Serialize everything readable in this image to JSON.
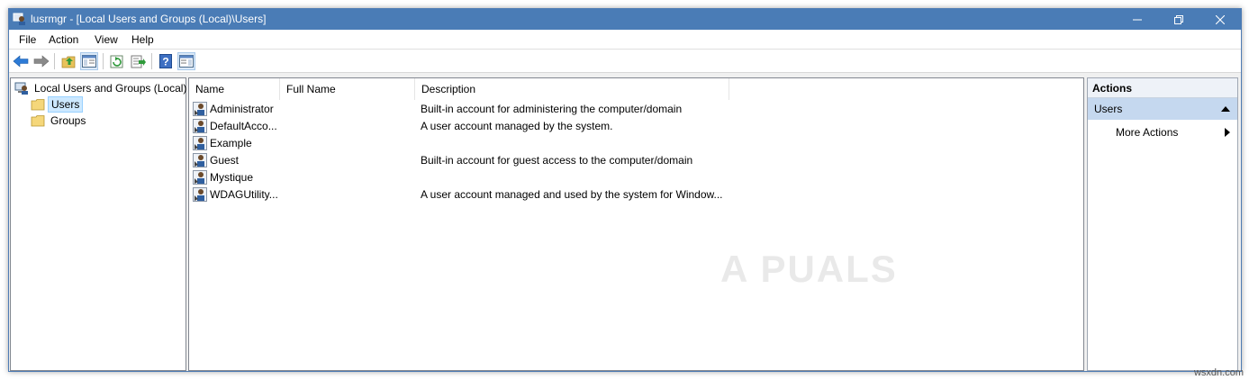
{
  "window": {
    "title": "lusrmgr - [Local Users and Groups (Local)\\Users]"
  },
  "menu": {
    "items": [
      "File",
      "Action",
      "View",
      "Help"
    ]
  },
  "toolbar": {
    "icons": [
      "back-arrow-icon",
      "forward-arrow-icon",
      "up-folder-icon",
      "show-hide-tree-icon",
      "refresh-icon",
      "export-list-icon",
      "help-icon",
      "show-hide-action-pane-icon"
    ]
  },
  "tree": {
    "root": "Local Users and Groups (Local)",
    "children": [
      "Users",
      "Groups"
    ],
    "selected": "Users"
  },
  "list": {
    "columns": [
      "Name",
      "Full Name",
      "Description"
    ],
    "rows": [
      {
        "name": "Administrator",
        "full_name": "",
        "description": "Built-in account for administering the computer/domain"
      },
      {
        "name": "DefaultAcco...",
        "full_name": "",
        "description": "A user account managed by the system."
      },
      {
        "name": "Example",
        "full_name": "",
        "description": ""
      },
      {
        "name": "Guest",
        "full_name": "",
        "description": "Built-in account for guest access to the computer/domain"
      },
      {
        "name": "Mystique",
        "full_name": "",
        "description": ""
      },
      {
        "name": "WDAGUtility...",
        "full_name": "",
        "description": "A user account managed and used by the system for Window..."
      }
    ]
  },
  "actions": {
    "header": "Actions",
    "section": "Users",
    "items": [
      "More Actions"
    ]
  },
  "overlay": {
    "watermark": "A  PUALS",
    "source": "wsxdn.com"
  },
  "colors": {
    "titlebar": "#4a7cb6",
    "selection": "#cce8ff",
    "actions_section": "#c5d8ef"
  }
}
